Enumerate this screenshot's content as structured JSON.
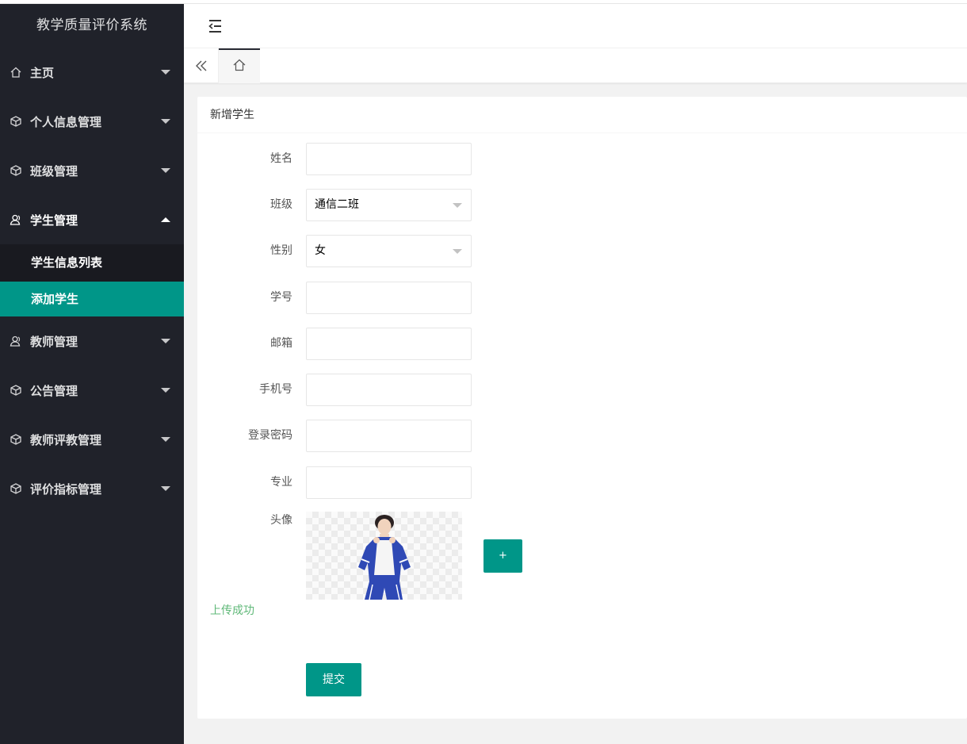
{
  "app": {
    "title": "教学质量评价系统"
  },
  "sidebar": {
    "items": [
      {
        "label": "主页",
        "icon": "home-icon"
      },
      {
        "label": "个人信息管理",
        "icon": "cube-icon"
      },
      {
        "label": "班级管理",
        "icon": "cube-icon"
      },
      {
        "label": "学生管理",
        "icon": "user-icon",
        "open": true,
        "children": [
          {
            "label": "学生信息列表"
          },
          {
            "label": "添加学生",
            "active": true
          }
        ]
      },
      {
        "label": "教师管理",
        "icon": "user-icon"
      },
      {
        "label": "公告管理",
        "icon": "cube-icon"
      },
      {
        "label": "教师评教管理",
        "icon": "cube-icon"
      },
      {
        "label": "评价指标管理",
        "icon": "cube-icon"
      }
    ]
  },
  "header": {
    "toggle_icon": "shrink-menu-icon"
  },
  "tabs": {
    "left_icon": "double-chevron-left-icon",
    "home_icon": "home-icon"
  },
  "form": {
    "title": "新增学生",
    "fields": {
      "name": {
        "label": "姓名",
        "value": ""
      },
      "class": {
        "label": "班级",
        "value": "通信二班"
      },
      "gender": {
        "label": "性别",
        "value": "女"
      },
      "student_no": {
        "label": "学号",
        "value": ""
      },
      "email": {
        "label": "邮箱",
        "value": ""
      },
      "phone": {
        "label": "手机号",
        "value": ""
      },
      "password": {
        "label": "登录密码",
        "value": ""
      },
      "major": {
        "label": "专业",
        "value": ""
      }
    },
    "avatar": {
      "label": "头像",
      "add_label": "+",
      "status": "上传成功"
    },
    "submit_label": "提交"
  },
  "colors": {
    "sidebar_bg": "#20222a",
    "accent": "#009688",
    "success_text": "#5FB878"
  }
}
